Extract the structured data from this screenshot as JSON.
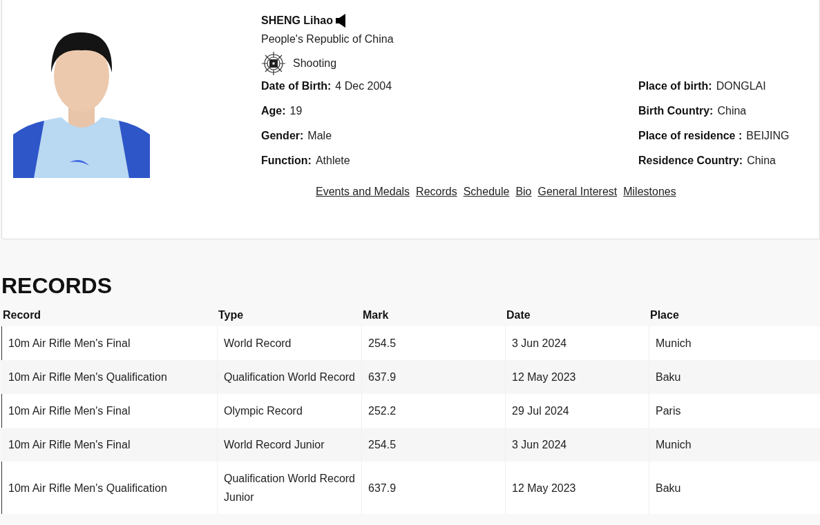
{
  "profile": {
    "name": "SHENG Lihao",
    "country": "People's Republic of China",
    "sport": "Shooting",
    "left_facts": [
      {
        "label": "Date of Birth:",
        "value": "4 Dec 2004"
      },
      {
        "label": "Age:",
        "value": "19"
      },
      {
        "label": "Gender:",
        "value": "Male"
      },
      {
        "label": "Function:",
        "value": "Athlete"
      }
    ],
    "right_facts": [
      {
        "label": "Place of birth:",
        "value": "DONGLAI"
      },
      {
        "label": "Birth Country:",
        "value": "China"
      },
      {
        "label": "Place of residence :",
        "value": "BEIJING"
      },
      {
        "label": "Residence Country:",
        "value": "China"
      }
    ],
    "links": [
      "Events and Medals",
      "Records",
      "Schedule",
      "Bio",
      "General Interest",
      "Milestones"
    ]
  },
  "records": {
    "heading": "RECORDS",
    "columns": [
      "Record",
      "Type",
      "Mark",
      "Date",
      "Place"
    ],
    "rows": [
      [
        "10m Air Rifle Men's Final",
        "World Record",
        "254.5",
        "3 Jun 2024",
        "Munich"
      ],
      [
        "10m Air Rifle Men's Qualification",
        "Qualification World Record",
        "637.9",
        "12 May 2023",
        "Baku"
      ],
      [
        "10m Air Rifle Men's Final",
        "Olympic Record",
        "252.2",
        "29 Jul 2024",
        "Paris"
      ],
      [
        "10m Air Rifle Men's Final",
        "World Record Junior",
        "254.5",
        "3 Jun 2024",
        "Munich"
      ],
      [
        "10m Air Rifle Men's Qualification",
        "Qualification World Record Junior",
        "637.9",
        "12 May 2023",
        "Baku"
      ]
    ]
  }
}
